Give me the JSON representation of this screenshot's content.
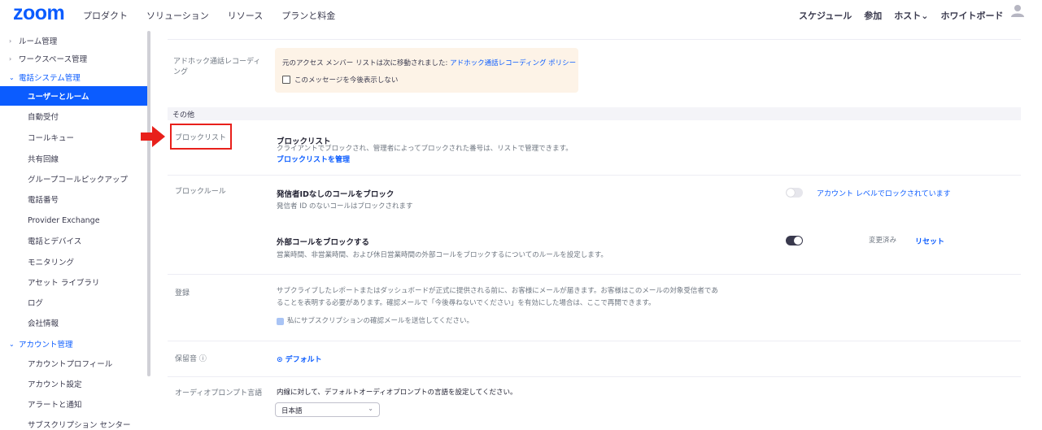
{
  "header": {
    "logo": "zoom",
    "nav_left": [
      "プロダクト",
      "ソリューション",
      "リソース",
      "プランと料金"
    ],
    "nav_right": [
      "スケジュール",
      "参加",
      "ホスト⌄",
      "ホワイトボード"
    ]
  },
  "sidebar": {
    "items": [
      {
        "label": "ルーム管理",
        "chevron": "›"
      },
      {
        "label": "ワークスペース管理",
        "chevron": "›"
      },
      {
        "label": "電話システム管理",
        "chevron": "⌄"
      },
      {
        "label": "ユーザーとルーム"
      },
      {
        "label": "自動受付"
      },
      {
        "label": "コールキュー"
      },
      {
        "label": "共有回線"
      },
      {
        "label": "グループコールピックアップ"
      },
      {
        "label": "電話番号"
      },
      {
        "label": "Provider Exchange"
      },
      {
        "label": "電話とデバイス"
      },
      {
        "label": "モニタリング"
      },
      {
        "label": "アセット ライブラリ"
      },
      {
        "label": "ログ"
      },
      {
        "label": "会社情報"
      },
      {
        "label": "アカウント管理",
        "chevron": "⌄"
      },
      {
        "label": "アカウントプロフィール"
      },
      {
        "label": "アカウント設定"
      },
      {
        "label": "アラートと通知"
      },
      {
        "label": "サブスクリプション センター"
      }
    ]
  },
  "adhoc": {
    "label": "アドホック通話レコーディング",
    "notice_text": "元のアクセス メンバー リストは次に移動されました: ",
    "notice_link": "アドホック通話レコーディング ポリシー",
    "checkbox_label": "このメッセージを今後表示しない"
  },
  "other_section": {
    "header": "その他"
  },
  "block_list": {
    "label": "ブロックリスト",
    "title": "ブロックリスト",
    "description": "クライアントでブロックされ、管理者によってブロックされた番号は、リストで管理できます。",
    "link": "ブロックリストを管理"
  },
  "block_rules": {
    "label": "ブロックルール",
    "rule1": {
      "title": "発信者IDなしのコールをブロック",
      "description": "発信者 ID のないコールはブロックされます",
      "toggle": "off",
      "lock_text": "アカウント レベルでロックされています"
    },
    "rule2": {
      "title": "外部コールをブロックする",
      "description": "営業時間、非営業時間、および休日営業時間の外部コールをブロックするについてのルールを設定します。",
      "toggle": "on",
      "modified": "変更済み",
      "reset": "リセット"
    }
  },
  "subscription": {
    "label": "登録",
    "description_line1": "サブクライブしたレポートまたはダッシュボードが正式に提供される前に、お客様にメールが届きます。お客様はこのメールの対象受信者であ",
    "description_line2": "ることを表明する必要があります。確認メールで「今後尋ねないでください」を有効にした場合は、ここで再開できます。",
    "checkbox_label": "私にサブスクリプションの確認メールを送信してください。"
  },
  "hold_music": {
    "label": "保留音 ⓘ",
    "value": "⊙ デフォルト"
  },
  "audio_prompt": {
    "label": "オーディオプロンプト言語",
    "description": "内線に対して、デフォルトオーディオプロンプトの言語を設定してください。",
    "selected": "日本語"
  },
  "colors": {
    "accent": "#0b5cff",
    "annotation": "#e8201b"
  }
}
